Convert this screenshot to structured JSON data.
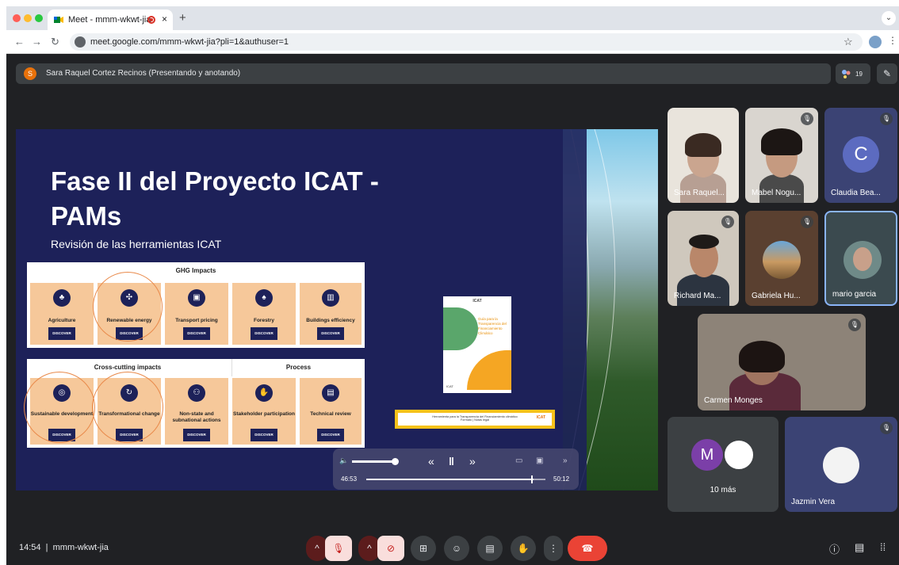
{
  "browser": {
    "tab_title": "Meet - mmm-wkwt-jia",
    "tab_close": "×",
    "new_tab": "+",
    "tab_menu": "⌄",
    "url": "meet.google.com/mmm-wkwt-jia?pli=1&authuser=1",
    "back": "←",
    "forward": "→",
    "reload": "↻",
    "star": "☆",
    "menu": "⋮"
  },
  "meet": {
    "presenter_initial": "S",
    "presenter_banner": "Sara Raquel Cortez Recinos (Presentando y anotando)",
    "participant_count": "19",
    "meeting_time": "14:54",
    "meeting_code": "mmm-wkwt-jia",
    "colors": {
      "end_call": "#ea4335",
      "muted_button": "#f9dedc",
      "active_tile_border": "#8ab4f8"
    }
  },
  "slide": {
    "title_line1": "Fase II del Proyecto ICAT -",
    "title_line2": "PAMs",
    "subtitle": "Revisión de las herramientas ICAT",
    "panel1_header": "GHG Impacts",
    "panel2_header": "Cross-cutting impacts",
    "panel3_header": "Process",
    "discover_label": "DISCOVER",
    "ghg_cards": [
      "Agriculture",
      "Renewable energy",
      "Transport pricing",
      "Forestry",
      "Buildings efficiency"
    ],
    "cross_cards": [
      "Sustainable development",
      "Transformational change",
      "Non-state and subnational actions"
    ],
    "process_cards": [
      "Stakeholder participation",
      "Technical review"
    ],
    "doc_header": "ICAT",
    "doc_title": "Guía para la Transparencia del Financiamiento Climático",
    "doc_footer": "ICAT",
    "bar_text": "Herramienta para la Transparencia del Financiamiento climático",
    "bar_subtext": "Formato | Notas legal",
    "bar_logo": "ICAT"
  },
  "player": {
    "current_time": "46:53",
    "total_time": "50:12",
    "progress": 0.934,
    "volume": 0.9
  },
  "participants": [
    {
      "name": "Sara Raquel...",
      "muted": false
    },
    {
      "name": "Mabel Nogu...",
      "muted": true
    },
    {
      "name": "Claudia Bea...",
      "muted": true,
      "initial": "C"
    },
    {
      "name": "Richard Ma...",
      "muted": true
    },
    {
      "name": "Gabriela Hu...",
      "muted": true
    },
    {
      "name": "mario garcia",
      "muted": false,
      "active": true
    },
    {
      "name": "Carmen Monges",
      "muted": true
    },
    {
      "name": "10 más",
      "initial": "M"
    },
    {
      "name": "Jazmin Vera",
      "muted": true
    }
  ],
  "icons": [
    "mic-off-icon",
    "camera-off-icon",
    "present-icon",
    "emoji-icon",
    "captions-icon",
    "raise-hand-icon",
    "more-icon",
    "end-call-icon",
    "info-icon",
    "chat-icon",
    "activities-icon"
  ]
}
